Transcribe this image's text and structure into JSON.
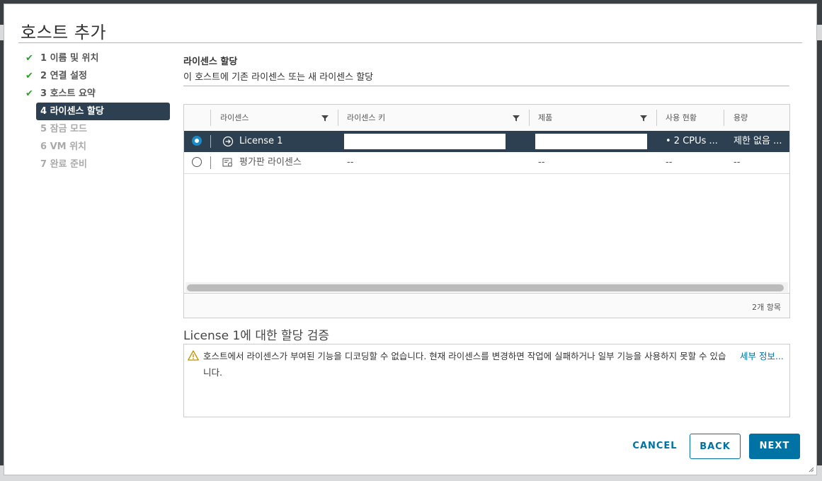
{
  "dialog": {
    "title": "호스트 추가"
  },
  "steps": [
    {
      "label": "1 이름 및 위치",
      "state": "done"
    },
    {
      "label": "2 연결 설정",
      "state": "done"
    },
    {
      "label": "3 호스트 요약",
      "state": "done"
    },
    {
      "label": "4 라이센스 할당",
      "state": "active"
    },
    {
      "label": "5 잠금 모드",
      "state": "future"
    },
    {
      "label": "6 VM 위치",
      "state": "future"
    },
    {
      "label": "7 완료 준비",
      "state": "future"
    }
  ],
  "section": {
    "title": "라이센스 할당",
    "subtitle": "이 호스트에 기존 라이센스 또는 새 라이센스 할당"
  },
  "grid": {
    "columns": [
      "라이센스",
      "라이센스 키",
      "제품",
      "사용 현황",
      "용량"
    ],
    "rows": [
      {
        "selected": true,
        "license": "License 1",
        "icon": "arrow-circle-icon",
        "key": "",
        "product": "",
        "usage": "• 2 CPUs ...",
        "capacity": "제한 없음 ..."
      },
      {
        "selected": false,
        "license": "평가판 라이센스",
        "icon": "license-doc-icon",
        "key": "--",
        "product": "--",
        "usage": "--",
        "capacity": "--"
      }
    ],
    "footer": "2개 항목"
  },
  "validation": {
    "title": "License 1에 대한 할당 검증",
    "message": "호스트에서 라이센스가 부여된 기능을 디코딩할 수 없습니다. 현재 라이센스를 변경하면 작업에 실패하거나 일부 기능을 사용하지 못할 수 있습니다.",
    "link": "세부 정보..."
  },
  "buttons": {
    "cancel": "CANCEL",
    "back": "BACK",
    "next": "NEXT"
  },
  "colors": {
    "accent": "#0072a3",
    "selected_row": "#2d4051",
    "check": "#309d2c",
    "warning": "#c48f00"
  }
}
